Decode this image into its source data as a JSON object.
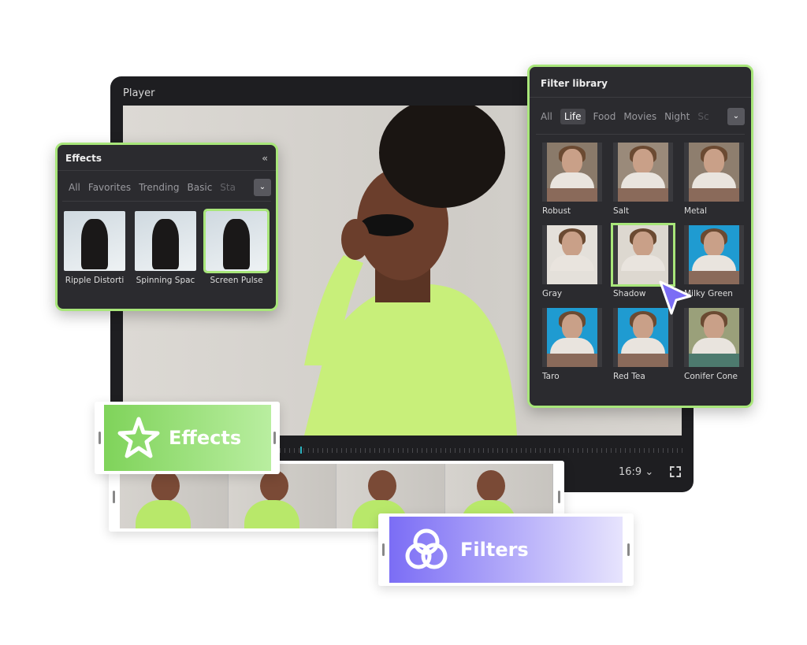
{
  "player": {
    "title": "Player",
    "aspect_ratio": "16:9",
    "playback_progress": 0.05
  },
  "effects_panel": {
    "title": "Effects",
    "tabs": [
      "All",
      "Favorites",
      "Trending",
      "Basic",
      "Sta"
    ],
    "items": [
      {
        "label": "Ripple Distorti",
        "selected": false
      },
      {
        "label": "Spinning Spac",
        "selected": false
      },
      {
        "label": "Screen Pulse",
        "selected": true
      }
    ]
  },
  "filter_library": {
    "title": "Filter library",
    "tabs": [
      "All",
      "Life",
      "Food",
      "Movies",
      "Night",
      "Sc"
    ],
    "active_tab": "Life",
    "items": [
      {
        "label": "Robust",
        "selected": false
      },
      {
        "label": "Salt",
        "selected": false
      },
      {
        "label": "Metal",
        "selected": false
      },
      {
        "label": "Gray",
        "selected": false
      },
      {
        "label": "Shadow",
        "selected": true
      },
      {
        "label": "Milky Green",
        "selected": false
      },
      {
        "label": "Taro",
        "selected": false
      },
      {
        "label": "Red Tea",
        "selected": false
      },
      {
        "label": "Conifer Cone",
        "selected": false
      }
    ]
  },
  "timeline": {
    "effects_clip_label": "Effects",
    "filters_clip_label": "Filters"
  },
  "colors": {
    "accent_green": "#a8e67a",
    "accent_purple": "#7b6df5",
    "panel_bg": "#2b2b2f"
  }
}
